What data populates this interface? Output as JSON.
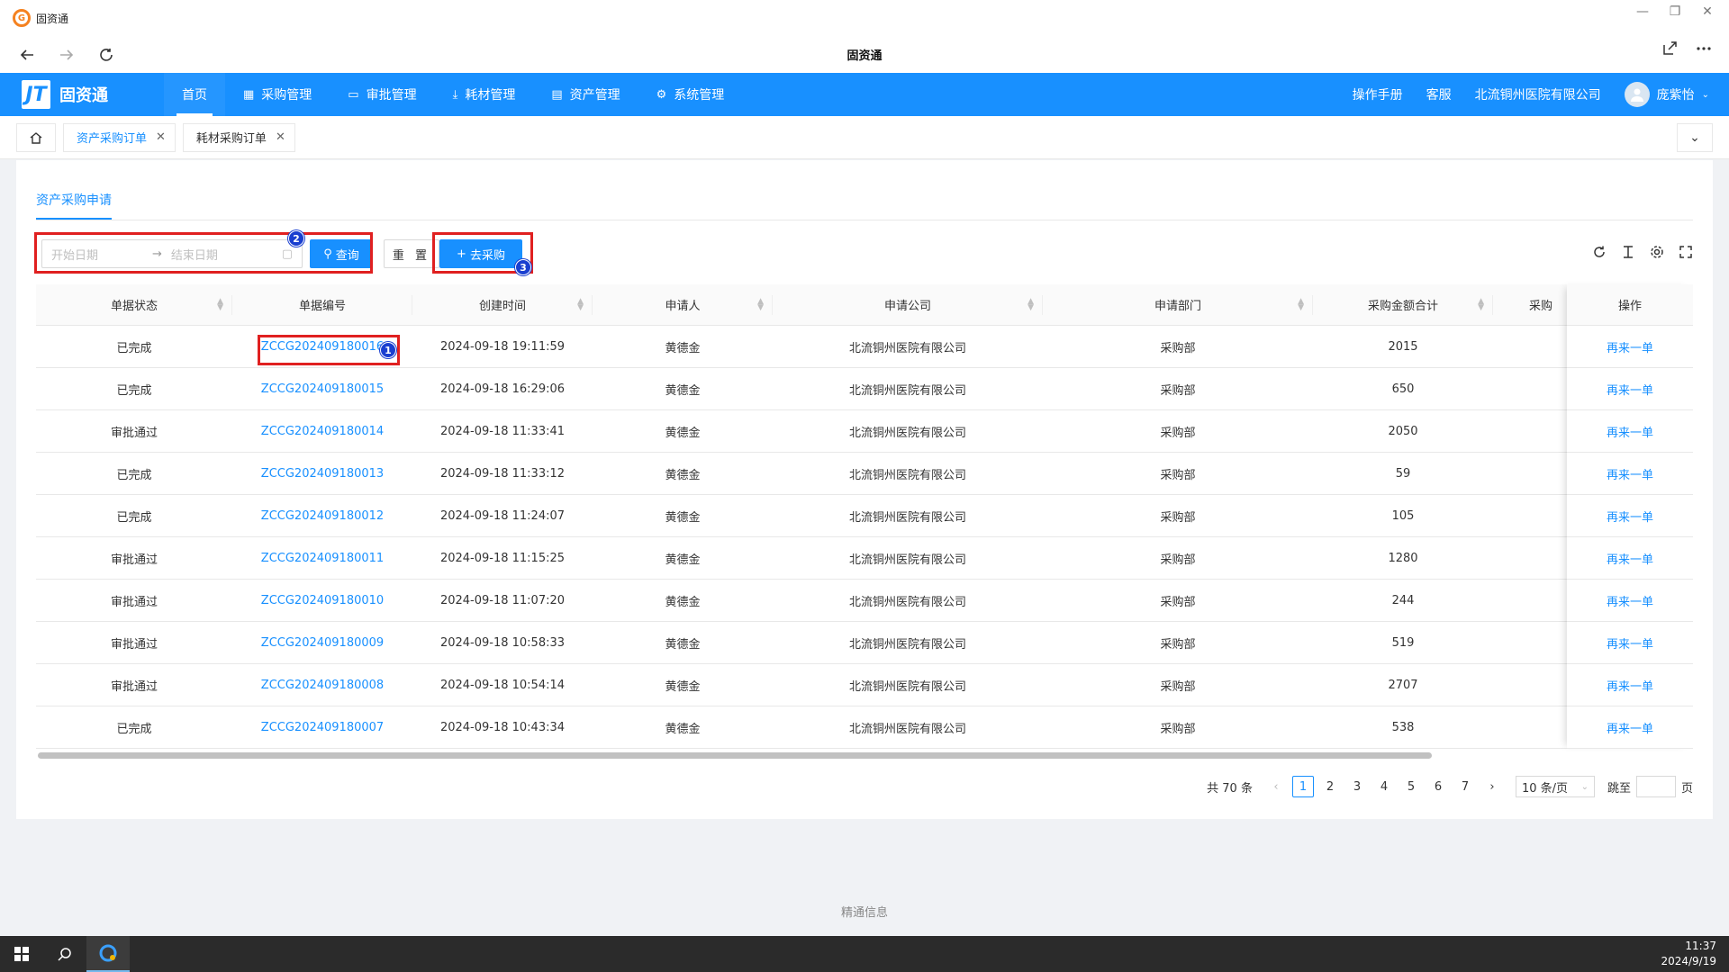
{
  "window": {
    "app_title": "固资通",
    "page_title": "固资通",
    "controls": [
      "—",
      "❐",
      "✕"
    ]
  },
  "header": {
    "brand": "固资通",
    "brand_mark": "JT",
    "menu": [
      {
        "label": "首页",
        "icon": ""
      },
      {
        "label": "采购管理",
        "icon": "grid-icon"
      },
      {
        "label": "审批管理",
        "icon": "monitor-icon"
      },
      {
        "label": "耗材管理",
        "icon": "download-icon"
      },
      {
        "label": "资产管理",
        "icon": "calendar-icon"
      },
      {
        "label": "系统管理",
        "icon": "gear-icon"
      }
    ],
    "manual": "操作手册",
    "support": "客服",
    "company": "北流铜州医院有限公司",
    "user": "庞紫怡"
  },
  "tabs": [
    {
      "label": "资产采购订单",
      "active": true
    },
    {
      "label": "耗材采购订单",
      "active": false
    }
  ],
  "content": {
    "sub_tab": "资产采购申请",
    "filters": {
      "start_placeholder": "开始日期",
      "end_placeholder": "结束日期",
      "query_label": "查询",
      "reset_label": "重 置",
      "new_label": "去采购"
    },
    "annotations": [
      "1",
      "2",
      "3"
    ],
    "table": {
      "columns": [
        "单据状态",
        "单据编号",
        "创建时间",
        "申请人",
        "申请公司",
        "申请部门",
        "采购金额合计",
        "采购",
        "操作"
      ],
      "rows": [
        {
          "status": "已完成",
          "no": "ZCCG202409180016",
          "time": "2024-09-18 19:11:59",
          "applicant": "黄德金",
          "company": "北流铜州医院有限公司",
          "dept": "采购部",
          "amount": "2015",
          "op": "再来一单"
        },
        {
          "status": "已完成",
          "no": "ZCCG202409180015",
          "time": "2024-09-18 16:29:06",
          "applicant": "黄德金",
          "company": "北流铜州医院有限公司",
          "dept": "采购部",
          "amount": "650",
          "op": "再来一单"
        },
        {
          "status": "审批通过",
          "no": "ZCCG202409180014",
          "time": "2024-09-18 11:33:41",
          "applicant": "黄德金",
          "company": "北流铜州医院有限公司",
          "dept": "采购部",
          "amount": "2050",
          "op": "再来一单"
        },
        {
          "status": "已完成",
          "no": "ZCCG202409180013",
          "time": "2024-09-18 11:33:12",
          "applicant": "黄德金",
          "company": "北流铜州医院有限公司",
          "dept": "采购部",
          "amount": "59",
          "op": "再来一单"
        },
        {
          "status": "已完成",
          "no": "ZCCG202409180012",
          "time": "2024-09-18 11:24:07",
          "applicant": "黄德金",
          "company": "北流铜州医院有限公司",
          "dept": "采购部",
          "amount": "105",
          "op": "再来一单"
        },
        {
          "status": "审批通过",
          "no": "ZCCG202409180011",
          "time": "2024-09-18 11:15:25",
          "applicant": "黄德金",
          "company": "北流铜州医院有限公司",
          "dept": "采购部",
          "amount": "1280",
          "op": "再来一单"
        },
        {
          "status": "审批通过",
          "no": "ZCCG202409180010",
          "time": "2024-09-18 11:07:20",
          "applicant": "黄德金",
          "company": "北流铜州医院有限公司",
          "dept": "采购部",
          "amount": "244",
          "op": "再来一单"
        },
        {
          "status": "审批通过",
          "no": "ZCCG202409180009",
          "time": "2024-09-18 10:58:33",
          "applicant": "黄德金",
          "company": "北流铜州医院有限公司",
          "dept": "采购部",
          "amount": "519",
          "op": "再来一单"
        },
        {
          "status": "审批通过",
          "no": "ZCCG202409180008",
          "time": "2024-09-18 10:54:14",
          "applicant": "黄德金",
          "company": "北流铜州医院有限公司",
          "dept": "采购部",
          "amount": "2707",
          "op": "再来一单"
        },
        {
          "status": "已完成",
          "no": "ZCCG202409180007",
          "time": "2024-09-18 10:43:34",
          "applicant": "黄德金",
          "company": "北流铜州医院有限公司",
          "dept": "采购部",
          "amount": "538",
          "op": "再来一单"
        }
      ]
    },
    "pagination": {
      "total": "共 70 条",
      "pages": [
        "1",
        "2",
        "3",
        "4",
        "5",
        "6",
        "7"
      ],
      "current": "1",
      "page_size": "10 条/页",
      "jump_label": "跳至",
      "page_suffix": "页"
    }
  },
  "footer": "精通信息",
  "taskbar": {
    "time": "11:37",
    "date": "2024/9/19"
  },
  "colors": {
    "primary": "#1890ff",
    "annotation_border": "#e02020",
    "annotation_badge": "#1a3fd0"
  }
}
